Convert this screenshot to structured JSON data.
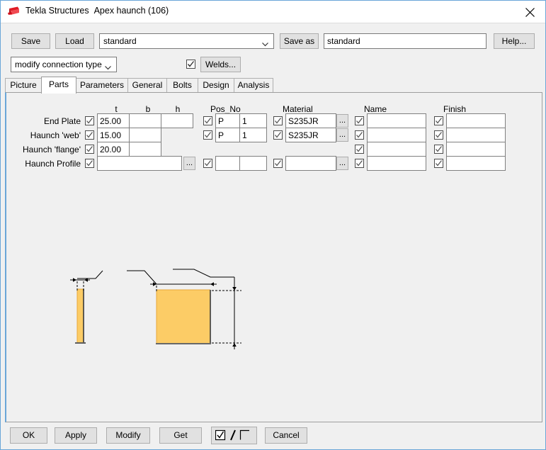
{
  "window": {
    "app_name": "Tekla Structures",
    "document_title": "Apex haunch (106)",
    "icon": "tekla-logo-icon",
    "close_icon": "close-icon"
  },
  "toolbar": {
    "save_label": "Save",
    "load_label": "Load",
    "attribute_combo_value": "standard",
    "save_as_label": "Save as",
    "save_as_value": "standard",
    "help_label": "Help...",
    "connection_type_combo_value": "modify connection type",
    "welds_checkbox_checked": true,
    "welds_label": "Welds..."
  },
  "tabs": [
    {
      "label": "Picture",
      "active": false
    },
    {
      "label": "Parts",
      "active": true
    },
    {
      "label": "Parameters",
      "active": false
    },
    {
      "label": "General",
      "active": false
    },
    {
      "label": "Bolts",
      "active": false
    },
    {
      "label": "Design",
      "active": false
    },
    {
      "label": "Analysis",
      "active": false
    }
  ],
  "parts_form": {
    "headers": {
      "t": "t",
      "b": "b",
      "h": "h",
      "pos_no": "Pos_No",
      "material": "Material",
      "name": "Name",
      "finish": "Finish"
    },
    "rows": [
      {
        "label": "End Plate",
        "dim_checked": true,
        "t": "25.00",
        "b": "",
        "h": "",
        "pos_checked": true,
        "pos_prefix": "P",
        "pos_number": "1",
        "material_checked": true,
        "material": "S235JR",
        "name_checked": true,
        "name": "",
        "finish_checked": true,
        "finish": ""
      },
      {
        "label": "Haunch 'web'",
        "dim_checked": true,
        "t": "15.00",
        "b": "",
        "h": null,
        "pos_checked": true,
        "pos_prefix": "P",
        "pos_number": "1",
        "material_checked": true,
        "material": "S235JR",
        "name_checked": true,
        "name": "",
        "finish_checked": true,
        "finish": ""
      },
      {
        "label": "Haunch 'flange'",
        "dim_checked": true,
        "t": "20.00",
        "b": "",
        "h": null,
        "pos_checked": null,
        "pos_prefix": null,
        "pos_number": null,
        "material_checked": null,
        "material": null,
        "name_checked": true,
        "name": "",
        "finish_checked": true,
        "finish": ""
      },
      {
        "label": "Haunch Profile",
        "dim_checked": true,
        "profile_value": "",
        "profile_browse_label": "...",
        "pos_checked": true,
        "pos_prefix": "",
        "pos_number": "",
        "material_checked": true,
        "material": "",
        "material_browse_label": "...",
        "name_checked": true,
        "name": "",
        "finish_checked": true,
        "finish": ""
      }
    ]
  },
  "diagram": {
    "name": "apex-haunch-preview",
    "part_fill_color": "#FCCC66",
    "part_edge_color": "#E8A83A",
    "line_color": "#000000"
  },
  "bottom_bar": {
    "ok_label": "OK",
    "apply_label": "Apply",
    "modify_label": "Modify",
    "get_label": "Get",
    "toggle_label": "/",
    "cancel_label": "Cancel"
  }
}
